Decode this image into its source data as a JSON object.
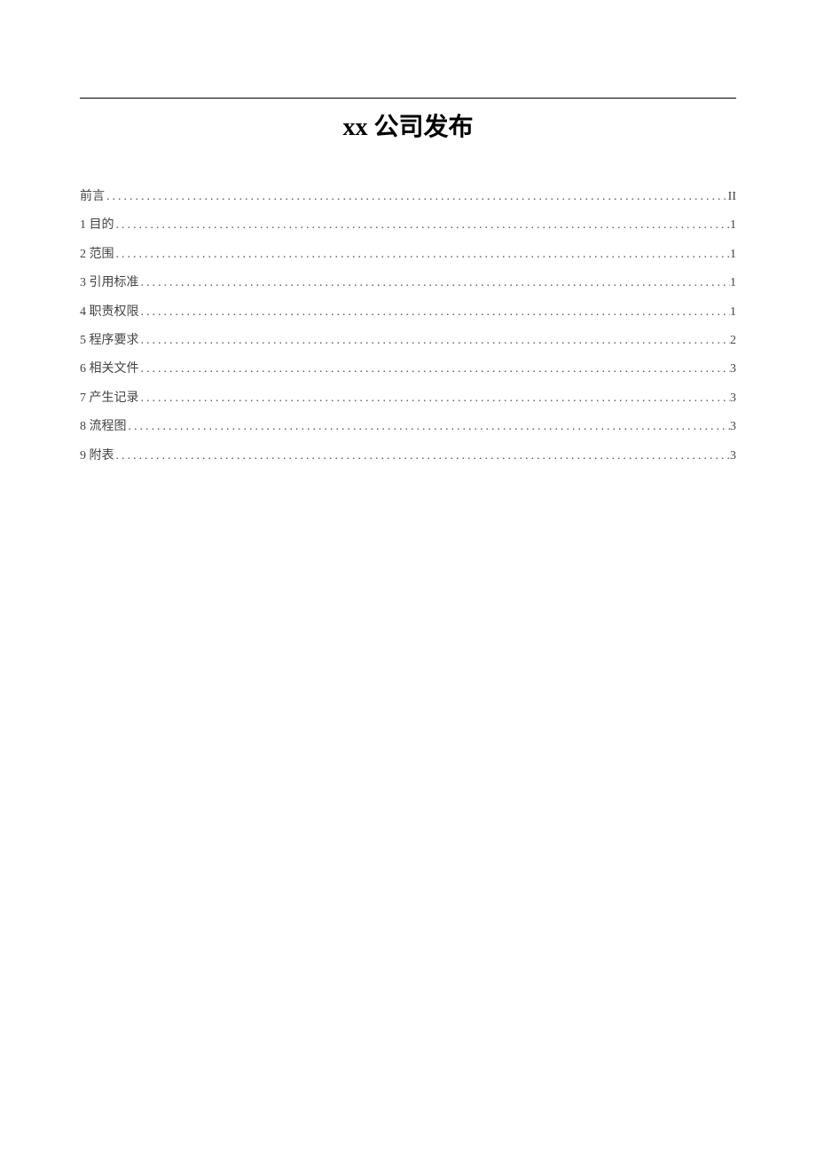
{
  "title": "xx 公司发布",
  "toc": [
    {
      "label": "前言",
      "page": "II"
    },
    {
      "label": "1 目的",
      "page": "1"
    },
    {
      "label": "2   范围",
      "page": "1"
    },
    {
      "label": "3 引用标准",
      "page": "1"
    },
    {
      "label": "4   职责权限",
      "page": "1"
    },
    {
      "label": "5 程序要求",
      "page": "2"
    },
    {
      "label": "6 相关文件",
      "page": "3"
    },
    {
      "label": "7 产生记录",
      "page": "3"
    },
    {
      "label": "8 流程图",
      "page": "3"
    },
    {
      "label": "9 附表",
      "page": "3"
    }
  ]
}
